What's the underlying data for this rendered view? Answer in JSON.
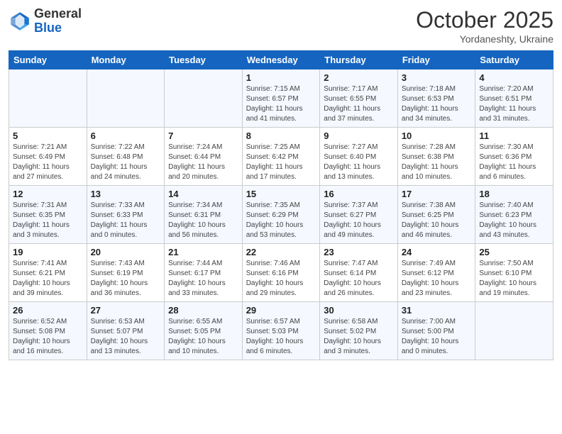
{
  "header": {
    "logo_general": "General",
    "logo_blue": "Blue",
    "month": "October 2025",
    "location": "Yordaneshty, Ukraine"
  },
  "days_of_week": [
    "Sunday",
    "Monday",
    "Tuesday",
    "Wednesday",
    "Thursday",
    "Friday",
    "Saturday"
  ],
  "weeks": [
    [
      {
        "day": "",
        "sunrise": "",
        "sunset": "",
        "daylight": ""
      },
      {
        "day": "",
        "sunrise": "",
        "sunset": "",
        "daylight": ""
      },
      {
        "day": "",
        "sunrise": "",
        "sunset": "",
        "daylight": ""
      },
      {
        "day": "1",
        "sunrise": "Sunrise: 7:15 AM",
        "sunset": "Sunset: 6:57 PM",
        "daylight": "Daylight: 11 hours and 41 minutes."
      },
      {
        "day": "2",
        "sunrise": "Sunrise: 7:17 AM",
        "sunset": "Sunset: 6:55 PM",
        "daylight": "Daylight: 11 hours and 37 minutes."
      },
      {
        "day": "3",
        "sunrise": "Sunrise: 7:18 AM",
        "sunset": "Sunset: 6:53 PM",
        "daylight": "Daylight: 11 hours and 34 minutes."
      },
      {
        "day": "4",
        "sunrise": "Sunrise: 7:20 AM",
        "sunset": "Sunset: 6:51 PM",
        "daylight": "Daylight: 11 hours and 31 minutes."
      }
    ],
    [
      {
        "day": "5",
        "sunrise": "Sunrise: 7:21 AM",
        "sunset": "Sunset: 6:49 PM",
        "daylight": "Daylight: 11 hours and 27 minutes."
      },
      {
        "day": "6",
        "sunrise": "Sunrise: 7:22 AM",
        "sunset": "Sunset: 6:48 PM",
        "daylight": "Daylight: 11 hours and 24 minutes."
      },
      {
        "day": "7",
        "sunrise": "Sunrise: 7:24 AM",
        "sunset": "Sunset: 6:44 PM",
        "daylight": "Daylight: 11 hours and 20 minutes."
      },
      {
        "day": "8",
        "sunrise": "Sunrise: 7:25 AM",
        "sunset": "Sunset: 6:42 PM",
        "daylight": "Daylight: 11 hours and 17 minutes."
      },
      {
        "day": "9",
        "sunrise": "Sunrise: 7:27 AM",
        "sunset": "Sunset: 6:40 PM",
        "daylight": "Daylight: 11 hours and 13 minutes."
      },
      {
        "day": "10",
        "sunrise": "Sunrise: 7:28 AM",
        "sunset": "Sunset: 6:38 PM",
        "daylight": "Daylight: 11 hours and 10 minutes."
      },
      {
        "day": "11",
        "sunrise": "Sunrise: 7:30 AM",
        "sunset": "Sunset: 6:36 PM",
        "daylight": "Daylight: 11 hours and 6 minutes."
      }
    ],
    [
      {
        "day": "12",
        "sunrise": "Sunrise: 7:31 AM",
        "sunset": "Sunset: 6:35 PM",
        "daylight": "Daylight: 11 hours and 3 minutes."
      },
      {
        "day": "13",
        "sunrise": "Sunrise: 7:33 AM",
        "sunset": "Sunset: 6:33 PM",
        "daylight": "Daylight: 11 hours and 0 minutes."
      },
      {
        "day": "14",
        "sunrise": "Sunrise: 7:34 AM",
        "sunset": "Sunset: 6:31 PM",
        "daylight": "Daylight: 10 hours and 56 minutes."
      },
      {
        "day": "15",
        "sunrise": "Sunrise: 7:35 AM",
        "sunset": "Sunset: 6:29 PM",
        "daylight": "Daylight: 10 hours and 53 minutes."
      },
      {
        "day": "16",
        "sunrise": "Sunrise: 7:37 AM",
        "sunset": "Sunset: 6:27 PM",
        "daylight": "Daylight: 10 hours and 49 minutes."
      },
      {
        "day": "17",
        "sunrise": "Sunrise: 7:38 AM",
        "sunset": "Sunset: 6:25 PM",
        "daylight": "Daylight: 10 hours and 46 minutes."
      },
      {
        "day": "18",
        "sunrise": "Sunrise: 7:40 AM",
        "sunset": "Sunset: 6:23 PM",
        "daylight": "Daylight: 10 hours and 43 minutes."
      }
    ],
    [
      {
        "day": "19",
        "sunrise": "Sunrise: 7:41 AM",
        "sunset": "Sunset: 6:21 PM",
        "daylight": "Daylight: 10 hours and 39 minutes."
      },
      {
        "day": "20",
        "sunrise": "Sunrise: 7:43 AM",
        "sunset": "Sunset: 6:19 PM",
        "daylight": "Daylight: 10 hours and 36 minutes."
      },
      {
        "day": "21",
        "sunrise": "Sunrise: 7:44 AM",
        "sunset": "Sunset: 6:17 PM",
        "daylight": "Daylight: 10 hours and 33 minutes."
      },
      {
        "day": "22",
        "sunrise": "Sunrise: 7:46 AM",
        "sunset": "Sunset: 6:16 PM",
        "daylight": "Daylight: 10 hours and 29 minutes."
      },
      {
        "day": "23",
        "sunrise": "Sunrise: 7:47 AM",
        "sunset": "Sunset: 6:14 PM",
        "daylight": "Daylight: 10 hours and 26 minutes."
      },
      {
        "day": "24",
        "sunrise": "Sunrise: 7:49 AM",
        "sunset": "Sunset: 6:12 PM",
        "daylight": "Daylight: 10 hours and 23 minutes."
      },
      {
        "day": "25",
        "sunrise": "Sunrise: 7:50 AM",
        "sunset": "Sunset: 6:10 PM",
        "daylight": "Daylight: 10 hours and 19 minutes."
      }
    ],
    [
      {
        "day": "26",
        "sunrise": "Sunrise: 6:52 AM",
        "sunset": "Sunset: 5:08 PM",
        "daylight": "Daylight: 10 hours and 16 minutes."
      },
      {
        "day": "27",
        "sunrise": "Sunrise: 6:53 AM",
        "sunset": "Sunset: 5:07 PM",
        "daylight": "Daylight: 10 hours and 13 minutes."
      },
      {
        "day": "28",
        "sunrise": "Sunrise: 6:55 AM",
        "sunset": "Sunset: 5:05 PM",
        "daylight": "Daylight: 10 hours and 10 minutes."
      },
      {
        "day": "29",
        "sunrise": "Sunrise: 6:57 AM",
        "sunset": "Sunset: 5:03 PM",
        "daylight": "Daylight: 10 hours and 6 minutes."
      },
      {
        "day": "30",
        "sunrise": "Sunrise: 6:58 AM",
        "sunset": "Sunset: 5:02 PM",
        "daylight": "Daylight: 10 hours and 3 minutes."
      },
      {
        "day": "31",
        "sunrise": "Sunrise: 7:00 AM",
        "sunset": "Sunset: 5:00 PM",
        "daylight": "Daylight: 10 hours and 0 minutes."
      },
      {
        "day": "",
        "sunrise": "",
        "sunset": "",
        "daylight": ""
      }
    ]
  ]
}
